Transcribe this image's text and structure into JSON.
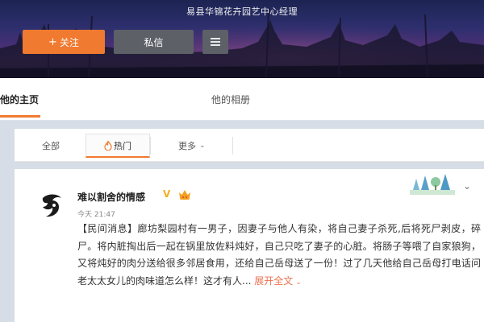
{
  "profile": {
    "subtitle": "易县华锦花卉园艺中心经理"
  },
  "actions": {
    "follow_label": "关注",
    "follow_plus": "+",
    "message_label": "私信",
    "menu_icon": "menu-icon"
  },
  "nav": {
    "home_label": "他的主页",
    "album_label": "他的相册"
  },
  "feed_tabs": {
    "all_label": "全部",
    "hot_label": "热门",
    "more_label": "更多",
    "more_chevron": "⌄"
  },
  "post": {
    "user_name": "难以割舍的情感",
    "verify_mark": "V",
    "time": "今天 21:47",
    "text": "【民间消息】廊坊梨园村有一男子，因妻子与他人有染，将自己妻子杀死,后将死尸剥皮，碎尸。将内脏掏出后一起在锅里放佐料炖好，自己只吃了妻子的心脏。将肠子等喂了自家狼狗，又将炖好的肉分送给很多邻居食用，还给自己岳母送了一份！过了几天他给自己岳母打电话问老太太女儿的肉味道怎么样！这才有人...",
    "expand_label": "展开全文",
    "expand_chevron": "⌄",
    "menu_chevron": "⌄"
  },
  "colors": {
    "accent": "#f07a2f",
    "link": "#eb7350",
    "verify": "#f2b01e"
  }
}
